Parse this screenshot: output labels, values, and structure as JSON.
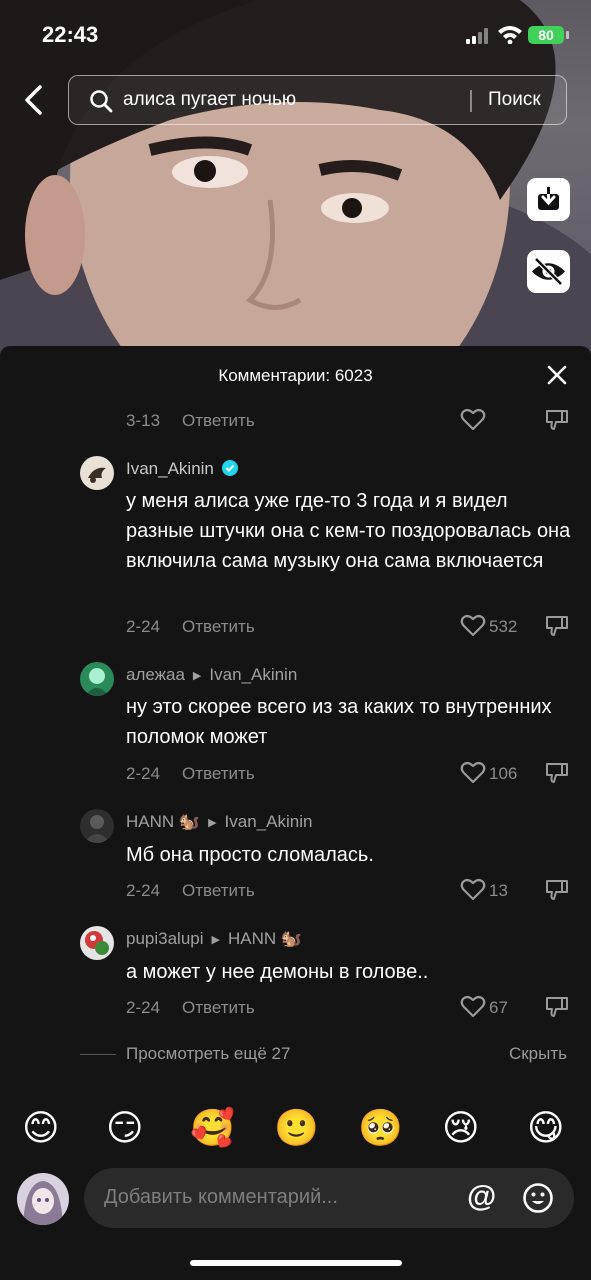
{
  "status_bar": {
    "time": "22:43",
    "battery": "80"
  },
  "search": {
    "query": "алиса пугает ночью",
    "button_label": "Поиск"
  },
  "comments_panel": {
    "title": "Комментарии: 6023",
    "top_meta": {
      "date": "3-13",
      "reply_label": "Ответить"
    },
    "comments": [
      {
        "user": "Ivan_Akinin",
        "verified": true,
        "reply_to": "",
        "text": "у меня алиса уже где-то 3 года и я видел разные штучки она с кем-то поздоровалась она включила сама музыку она сама включается",
        "date": "2-24",
        "reply_label": "Ответить",
        "likes": "532"
      },
      {
        "user": "алежаа",
        "reply_to": "Ivan_Akinin",
        "text": "ну это скорее всего из за каких то внутренних поломок может",
        "date": "2-24",
        "reply_label": "Ответить",
        "likes": "106"
      },
      {
        "user": "HANN 🐿️",
        "reply_to": "Ivan_Akinin",
        "text": "Мб она просто сломалась.",
        "date": "2-24",
        "reply_label": "Ответить",
        "likes": "13"
      },
      {
        "user": "pupi3alupi",
        "reply_to": "HANN 🐿️",
        "text": "а может у нее демоны в голове..",
        "date": "2-24",
        "reply_label": "Ответить",
        "likes": "67"
      }
    ],
    "view_more": "Просмотреть ещё 27",
    "hide": "Скрыть"
  },
  "emoji_bar": [
    "😊",
    "😏",
    "🥰",
    "🙂",
    "🥺",
    "😢",
    "😋"
  ],
  "input": {
    "placeholder": "Добавить комментарий...",
    "at_symbol": "@"
  },
  "colors": {
    "panel_bg": "#141414",
    "muted_text": "#8b8b8b",
    "verified": "#20d5ec",
    "battery": "#3fd15a"
  }
}
